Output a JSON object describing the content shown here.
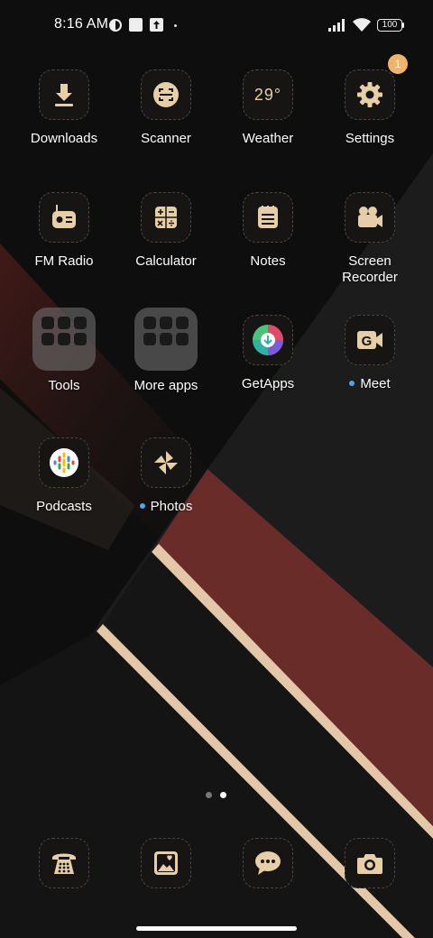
{
  "status": {
    "time": "8:16 AM",
    "battery": "100"
  },
  "apps": {
    "row1": [
      {
        "label": "Downloads",
        "icon": "download-icon"
      },
      {
        "label": "Scanner",
        "icon": "scanner-icon"
      },
      {
        "label": "Weather",
        "icon": "weather-icon",
        "value": "29°"
      },
      {
        "label": "Settings",
        "icon": "gear-icon",
        "badge": "1"
      }
    ],
    "row2": [
      {
        "label": "FM Radio",
        "icon": "radio-icon"
      },
      {
        "label": "Calculator",
        "icon": "calculator-icon"
      },
      {
        "label": "Notes",
        "icon": "notes-icon"
      },
      {
        "label": "Screen Recorder",
        "icon": "video-camera-icon"
      }
    ],
    "row3": [
      {
        "label": "Tools",
        "icon": "folder-icon"
      },
      {
        "label": "More apps",
        "icon": "folder-icon"
      },
      {
        "label": "GetApps",
        "icon": "getapps-icon"
      },
      {
        "label": "Meet",
        "icon": "meet-icon"
      }
    ],
    "row4": [
      {
        "label": "Podcasts",
        "icon": "podcasts-icon"
      },
      {
        "label": "Photos",
        "icon": "pinwheel-icon"
      }
    ]
  },
  "dock": [
    {
      "icon": "phone-icon"
    },
    {
      "icon": "gallery-icon"
    },
    {
      "icon": "message-icon"
    },
    {
      "icon": "camera-icon"
    }
  ],
  "colors": {
    "gold": "#e6cfa6",
    "badge": "#f0b36b",
    "new_dot": "#4aa8e8"
  }
}
